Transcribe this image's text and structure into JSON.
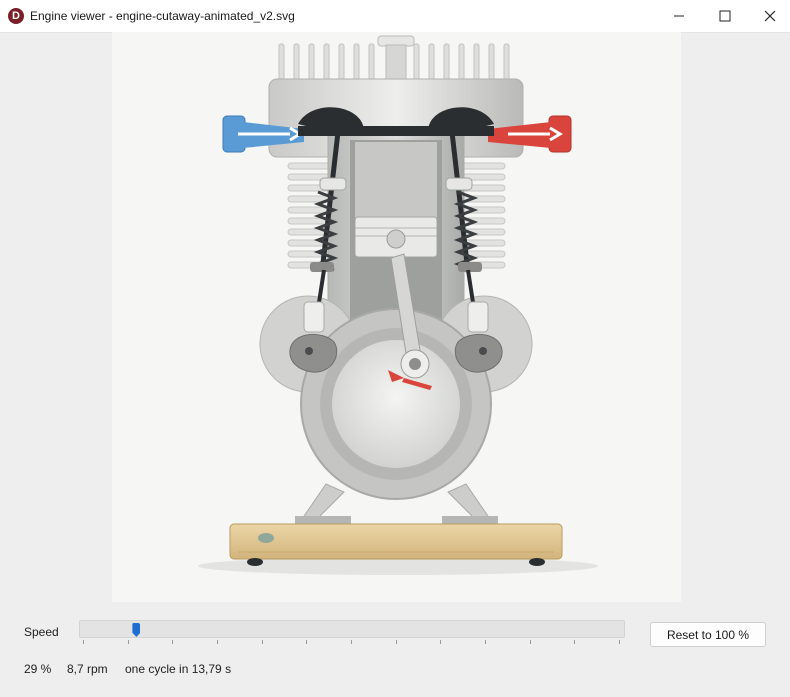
{
  "window": {
    "app_icon_letter": "D",
    "title": "Engine viewer - engine-cutaway-animated_v2.svg"
  },
  "viewer": {
    "content": "engine-cutaway-diagram",
    "colors": {
      "intake": "#5b9bd5",
      "exhaust": "#d9453c",
      "background": "#f6f6f4",
      "base": "#dcc08a"
    }
  },
  "controls": {
    "speed_label": "Speed",
    "speed_slider_fraction": 0.1,
    "speed_slider_ticks": 13,
    "reset_label": "Reset to 100 %"
  },
  "status": {
    "percent": "29 %",
    "rpm": "8,7 rpm",
    "cycle": "one cycle in 13,79 s"
  },
  "accent_color": "#1e6fcf"
}
